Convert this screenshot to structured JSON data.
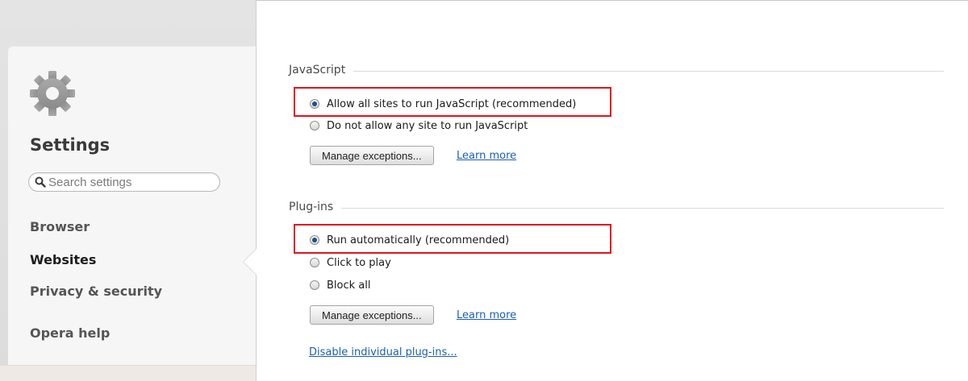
{
  "sidebar": {
    "title": "Settings",
    "search_placeholder": "Search settings",
    "nav": [
      {
        "label": "Browser"
      },
      {
        "label": "Websites"
      },
      {
        "label": "Privacy & security"
      },
      {
        "label": "Opera help"
      }
    ],
    "active": "Websites"
  },
  "javascript": {
    "title": "JavaScript",
    "options": [
      {
        "label": "Allow all sites to run JavaScript (recommended)",
        "checked": true
      },
      {
        "label": "Do not allow any site to run JavaScript",
        "checked": false
      }
    ],
    "manage_label": "Manage exceptions...",
    "learn_more_label": "Learn more"
  },
  "plugins": {
    "title": "Plug-ins",
    "options": [
      {
        "label": "Run automatically (recommended)",
        "checked": true
      },
      {
        "label": "Click to play",
        "checked": false
      },
      {
        "label": "Block all",
        "checked": false
      }
    ],
    "manage_label": "Manage exceptions...",
    "learn_more_label": "Learn more",
    "disable_link_label": "Disable individual plug-ins..."
  },
  "colors": {
    "highlight": "#e0141c",
    "link": "#1a5fb4",
    "radio_dot": "#1f4e8e"
  },
  "icons": {
    "settings": "gear-icon",
    "search": "search-icon"
  }
}
